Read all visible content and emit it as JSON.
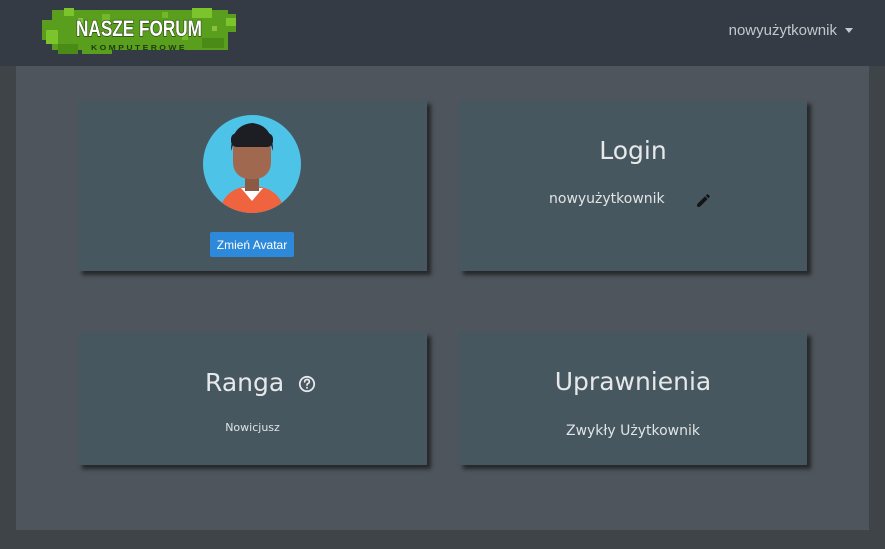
{
  "header": {
    "logo_title": "NASZE FORUM",
    "logo_subtitle": "KOMPUTEROWE",
    "username": "nowyużytkownik"
  },
  "profile": {
    "avatar_button_label": "Zmień Avatar",
    "login": {
      "title": "Login",
      "value": "nowyużytkownik"
    },
    "rank": {
      "title": "Ranga",
      "value": "Nowicjusz"
    },
    "permissions": {
      "title": "Uprawnienia",
      "value": "Zwykły Użytkownik"
    }
  },
  "colors": {
    "navbar": "#353b44",
    "card": "#46575f",
    "button": "#2d89d9",
    "logo_green": "#5a9e1e",
    "avatar_bg": "#4ec3e8"
  },
  "icons": [
    "chevron-down-icon",
    "pencil-icon",
    "help-circle-icon"
  ]
}
